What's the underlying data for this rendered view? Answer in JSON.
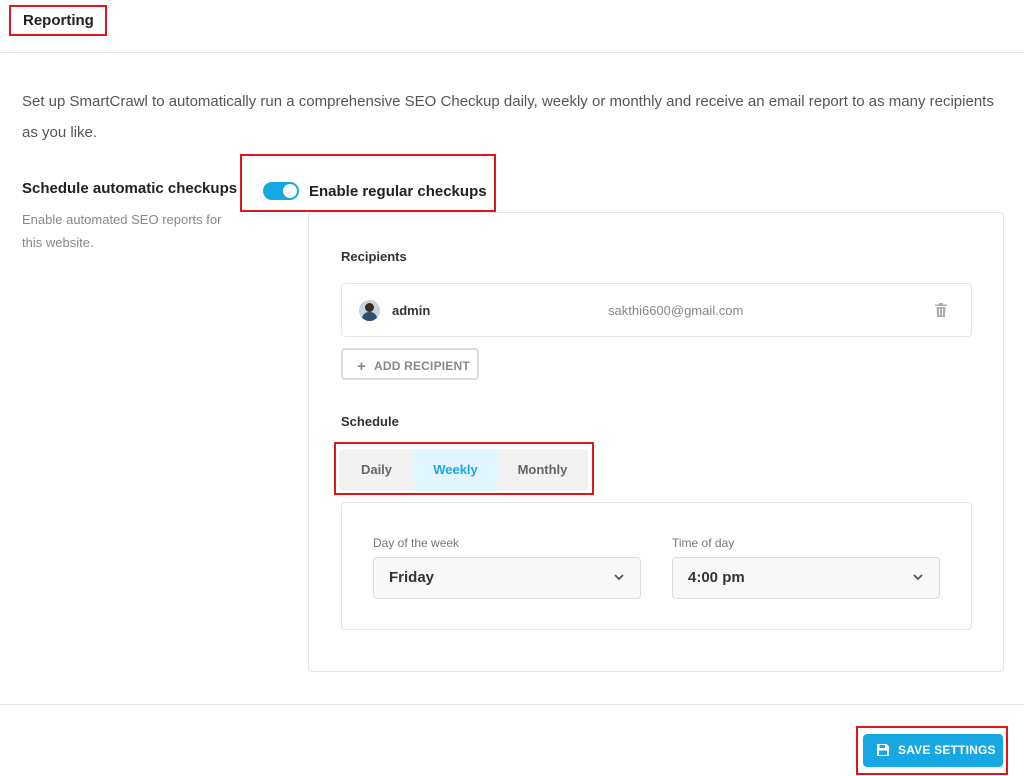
{
  "header": {
    "title": "Reporting"
  },
  "intro": "Set up SmartCrawl to automatically run a comprehensive SEO Checkup daily, weekly or monthly and receive an email report to as many recipients as you like.",
  "section": {
    "label": "Schedule automatic checkups",
    "description": "Enable automated SEO reports for this website."
  },
  "toggle": {
    "label": "Enable regular checkups",
    "enabled": true
  },
  "recipients": {
    "title": "Recipients",
    "items": [
      {
        "name": "admin",
        "email": "sakthi6600@gmail.com"
      }
    ],
    "add_label": "ADD RECIPIENT"
  },
  "schedule": {
    "title": "Schedule",
    "tabs": [
      {
        "label": "Daily"
      },
      {
        "label": "Weekly"
      },
      {
        "label": "Monthly"
      }
    ],
    "active_tab": "Weekly",
    "day_label": "Day of the week",
    "day_value": "Friday",
    "time_label": "Time of day",
    "time_value": "4:00 pm"
  },
  "footer": {
    "save_label": "SAVE SETTINGS"
  },
  "colors": {
    "accent": "#17a8e3",
    "highlight": "#e0161e"
  },
  "icons": {
    "add": "plus-icon",
    "delete": "trash-icon",
    "dropdown": "chevron-down-icon",
    "save": "floppy-disk-icon"
  }
}
